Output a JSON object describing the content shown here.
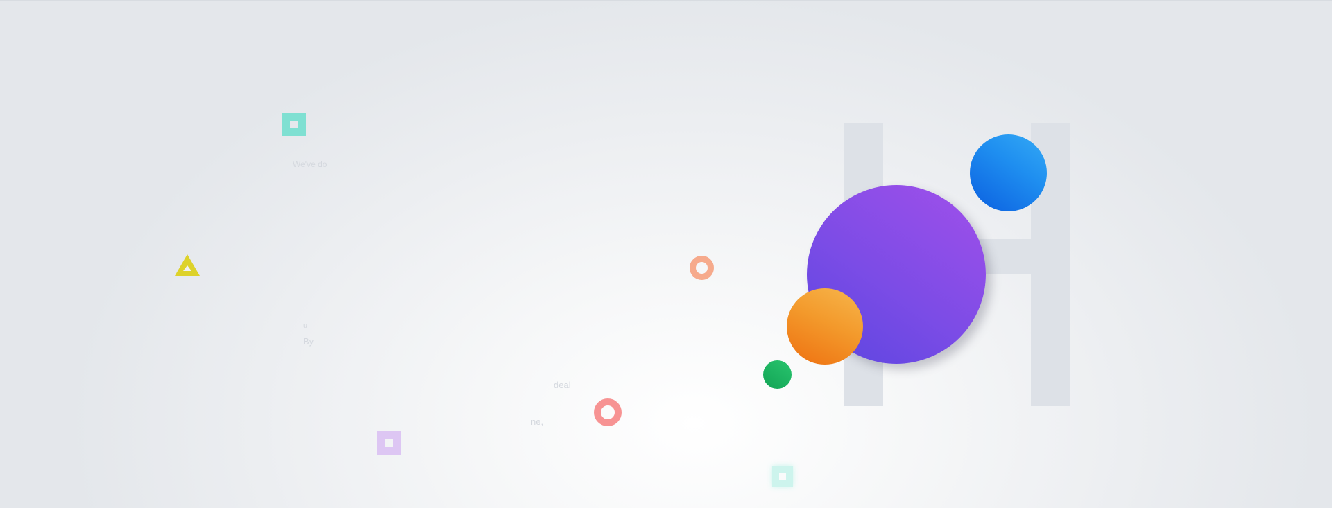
{
  "background": {
    "gradient_colors": [
      "#ffffff",
      "#e4e7eb"
    ],
    "letter": "H",
    "letter_color": "#dde1e7"
  },
  "faint_text": {
    "line1": "We've do",
    "line2": "u",
    "line3": "By",
    "line4": "deal",
    "line5": "ne,"
  },
  "shapes": {
    "purple_circle": {
      "colors": [
        "#5a45e0",
        "#a150ea"
      ]
    },
    "blue_circle": {
      "colors": [
        "#0b5fe0",
        "#35aaf5"
      ]
    },
    "orange_circle": {
      "colors": [
        "#ee7010",
        "#f7b64c"
      ]
    },
    "green_circle": {
      "colors": [
        "#12a455",
        "#29c46e"
      ]
    },
    "peach_ring": {
      "color": "#f6aa8c"
    },
    "coral_ring": {
      "color": "#f79393"
    },
    "teal_square": {
      "color": "#7fe0d2"
    },
    "lilac_square": {
      "color": "#ddc6f3"
    },
    "mint_square": {
      "color": "#c9f4ec"
    },
    "yellow_triangle": {
      "color": "#ddd22a"
    }
  }
}
